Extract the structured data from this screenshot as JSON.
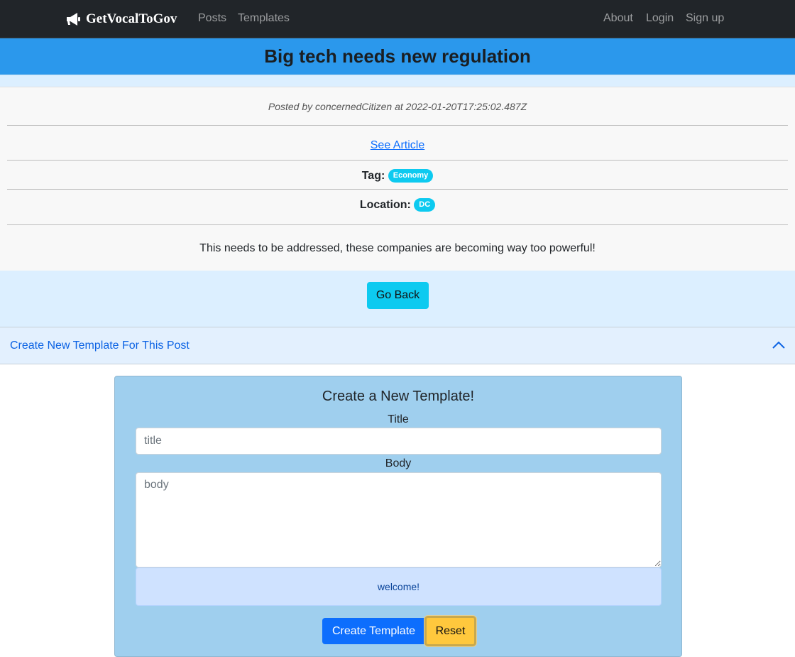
{
  "navbar": {
    "brand": "GetVocalToGov",
    "brand_icon": "megaphone-icon",
    "links_left": [
      "Posts",
      "Templates"
    ],
    "links_right": [
      "About",
      "Login",
      "Sign up"
    ]
  },
  "post": {
    "title": "Big tech needs new regulation",
    "meta": "Posted by concernedCitizen at 2022-01-20T17:25:02.487Z",
    "article_link": "See Article",
    "tag_label": "Tag:",
    "tag_value": "Economy",
    "location_label": "Location:",
    "location_value": "DC",
    "body": "This needs to be addressed, these companies are becoming way too powerful!"
  },
  "go_back_label": "Go Back",
  "accordion": {
    "title": "Create New Template For This Post",
    "chevron_icon": "chevron-up-icon"
  },
  "form": {
    "heading": "Create a New Template!",
    "title_label": "Title",
    "title_placeholder": "title",
    "body_label": "Body",
    "body_placeholder": "body",
    "alert": "welcome!",
    "create_label": "Create Template",
    "reset_label": "Reset"
  },
  "colors": {
    "navbar_bg": "#212529",
    "title_bar_bg": "#2b98ec",
    "badge_bg": "#0dcaf0",
    "panel_bg": "#9fcfee",
    "primary": "#0d6efd",
    "warning": "#ffc83d"
  }
}
